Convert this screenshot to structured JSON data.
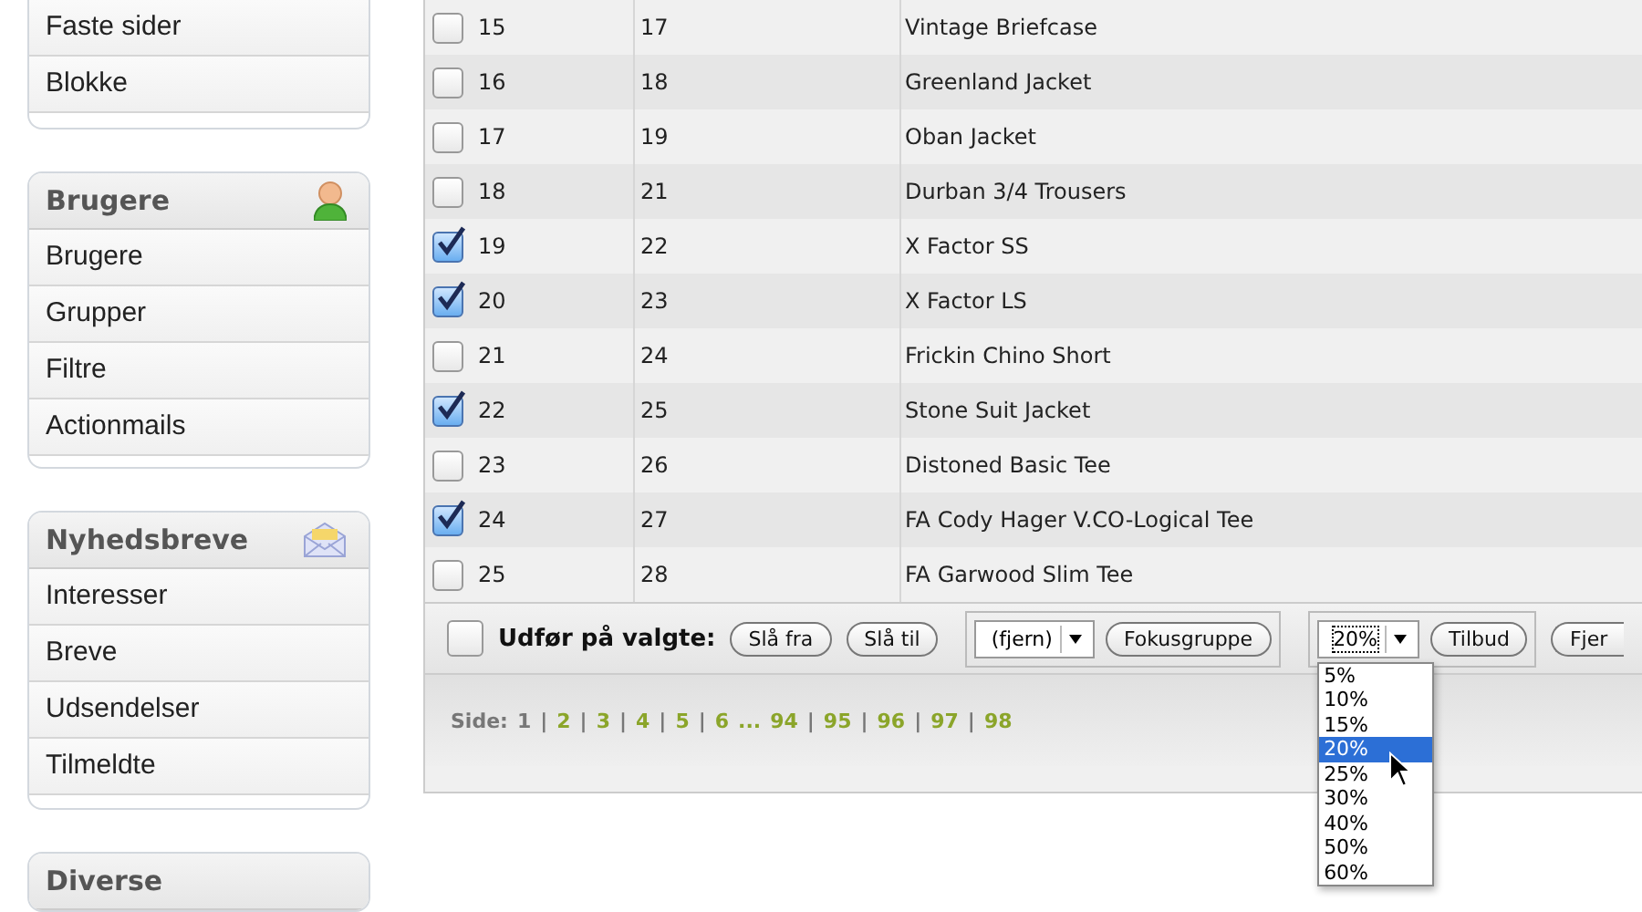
{
  "sidebar": [
    {
      "kind": "pages",
      "items": [
        "Faste sider",
        "Blokke"
      ]
    },
    {
      "kind": "users",
      "title": "Brugere",
      "items": [
        "Brugere",
        "Grupper",
        "Filtre",
        "Actionmails"
      ]
    },
    {
      "kind": "newsletters",
      "title": "Nyhedsbreve",
      "items": [
        "Interesser",
        "Breve",
        "Udsendelser",
        "Tilmeldte"
      ]
    },
    {
      "kind": "misc",
      "title": "Diverse"
    }
  ],
  "table": {
    "rows": [
      {
        "checked": false,
        "number": "15",
        "column_2": "17",
        "column_3": "Vintage Briefcase"
      },
      {
        "checked": false,
        "number": "16",
        "column_2": "18",
        "column_3": "Greenland Jacket"
      },
      {
        "checked": false,
        "number": "17",
        "column_2": "19",
        "column_3": "Oban Jacket"
      },
      {
        "checked": false,
        "number": "18",
        "column_2": "21",
        "column_3": "Durban 3/4 Trousers"
      },
      {
        "checked": true,
        "number": "19",
        "column_2": "22",
        "column_3": "X Factor SS"
      },
      {
        "checked": true,
        "number": "20",
        "column_2": "23",
        "column_3": "X Factor LS"
      },
      {
        "checked": false,
        "number": "21",
        "column_2": "24",
        "column_3": "Frickin Chino Short"
      },
      {
        "checked": true,
        "number": "22",
        "column_2": "25",
        "column_3": "Stone Suit Jacket"
      },
      {
        "checked": false,
        "number": "23",
        "column_2": "26",
        "column_3": "Distoned Basic Tee"
      },
      {
        "checked": true,
        "number": "24",
        "column_2": "27",
        "column_3": "FA Cody Hager V.CO-Logical Tee"
      },
      {
        "checked": false,
        "number": "25",
        "column_2": "28",
        "column_3": "FA Garwood Slim Tee"
      }
    ]
  },
  "actions": {
    "select_all_checked": false,
    "label": "Udfør på valgte:",
    "buttons": [
      "Slå fra",
      "Slå til"
    ],
    "groups": [
      {
        "select_value": "(fjern)",
        "button": "Fokusgruppe",
        "open": false
      },
      {
        "select_value": "20%",
        "button": "Tilbud",
        "open": true,
        "options": [
          {
            "label": "5%",
            "selected": false
          },
          {
            "label": "10%",
            "selected": false
          },
          {
            "label": "15%",
            "selected": false
          },
          {
            "label": "20%",
            "selected": true
          },
          {
            "label": "25%",
            "selected": false
          },
          {
            "label": "30%",
            "selected": false
          },
          {
            "label": "40%",
            "selected": false
          },
          {
            "label": "50%",
            "selected": false
          },
          {
            "label": "60%",
            "selected": false
          }
        ]
      }
    ],
    "last_button": "Fjer"
  },
  "pager": {
    "label": "Side:",
    "separator": "|",
    "items": [
      {
        "kind": "page",
        "label": "1",
        "selected": true
      },
      {
        "kind": "page",
        "label": "2",
        "selected": false
      },
      {
        "kind": "page",
        "label": "3",
        "selected": false
      },
      {
        "kind": "page",
        "label": "4",
        "selected": false
      },
      {
        "kind": "page",
        "label": "5",
        "selected": false
      },
      {
        "kind": "page",
        "label": "6",
        "selected": false
      },
      {
        "kind": "gap",
        "label": "..."
      },
      {
        "kind": "page",
        "label": "94",
        "selected": false
      },
      {
        "kind": "page",
        "label": "95",
        "selected": false
      },
      {
        "kind": "page",
        "label": "96",
        "selected": false
      },
      {
        "kind": "page",
        "label": "97",
        "selected": false
      },
      {
        "kind": "page",
        "label": "98",
        "selected": false
      }
    ]
  }
}
